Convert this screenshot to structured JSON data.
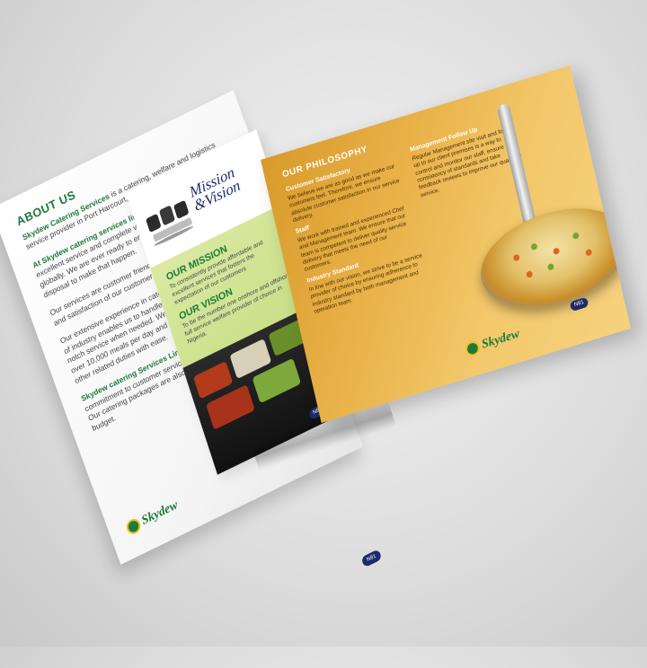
{
  "left_page": {
    "title": "ABOUT US",
    "p1_brand": "Skydew Catering Services",
    "p1_rest": " is a catering, welfare and logistics service provider in Port Harcourt, Nigeria.",
    "p2_brand": "At Skydew catering services limited,",
    "p2_rest": " we believe you deserve excellent service and complete value such as is obtainable globally. We are ever ready to employ all resources at our disposal to make that happen.",
    "p3": "Our services are customer friendly, designed to meet the need and satisfaction of our customers.",
    "p4": "Our extensive experience in catering services across all sectors of industry enables us to handle custom request and deliver top-notch service when needed. We have the capacity to provide over 10,000 meals per day and at the same time discharge other related duties with ease.",
    "p5_brand": "Skydew catering Services Limited",
    "p5_rest": " has an unmatched commitment to customer service, quality and attention to detail. Our catering packages are also designed to meet your taste and budget.",
    "logo": "Skydew",
    "page_number": "N81"
  },
  "middle_page": {
    "header_line1": "Mission",
    "header_line2": "&Vision",
    "mission_title": "OUR MISSION",
    "mission_text": "To consistently provide affordable and excellent services that fosters the expectation of our customers",
    "vision_title": "OUR VISION",
    "vision_text": "To be the number one onshore and offshore full service welfare provider of choice in Nigeria.",
    "page_number": "N81"
  },
  "right_page": {
    "title": "OUR PHILOSOPHY",
    "sections": [
      {
        "heading": "Customer Satisfactory",
        "text": "We believe we are as good as we make our customers feel. Therefore, we ensure absolute customer satisfaction in our service delivery."
      },
      {
        "heading": "Staff",
        "text": "We work with trained and experienced Chef and Management team. We ensure that our team is competent to deliver quality service delivery that meets the need of our customers."
      },
      {
        "heading": "Industry Standard",
        "text": "In line with our vision, we strive to be a service provider of choice by ensuring adherence to industry standard by both management and operation team."
      },
      {
        "heading": "Management Follow Up",
        "text": "Regular Management site visit and follow up to our client premises is a way to control and monitor our staff, ensure consistency of standards and take feedback reviews to improve our quality of service."
      }
    ],
    "logo": "Skydew",
    "page_number": "N81"
  }
}
